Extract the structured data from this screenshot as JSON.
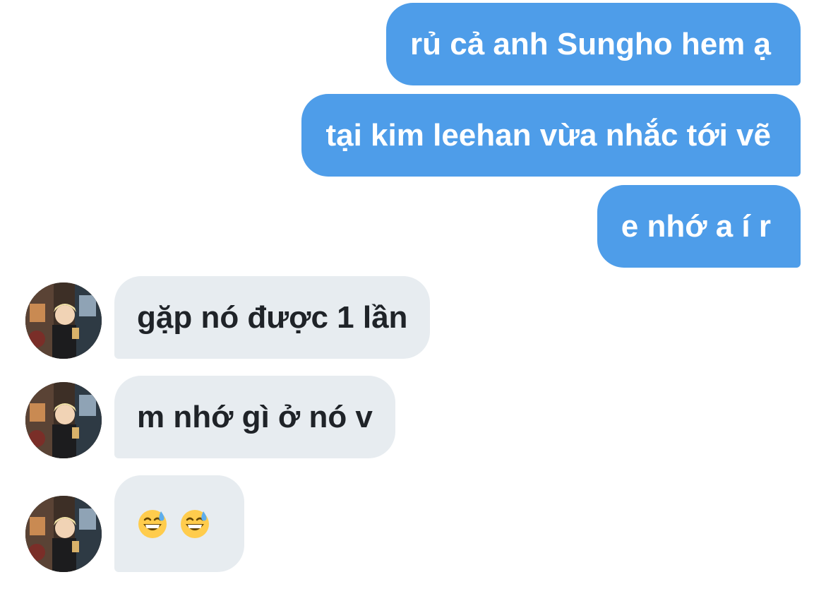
{
  "thread": {
    "outgoing": [
      {
        "text": "rủ cả anh Sungho hem ạ"
      },
      {
        "text": "tại kim leehan vừa nhắc tới vẽ"
      },
      {
        "text": "e nhớ a í r"
      }
    ],
    "incoming": [
      {
        "text": "gặp nó được 1 lần"
      },
      {
        "text": "m nhớ gì ở nó v"
      },
      {
        "emojis": [
          "grinning-face-with-sweat-emoji",
          "grinning-face-with-sweat-emoji"
        ]
      }
    ]
  },
  "colors": {
    "outgoing_bubble": "#4e9de9",
    "incoming_bubble": "#e7ecf0",
    "outgoing_text": "#ffffff",
    "incoming_text": "#1f2328"
  }
}
